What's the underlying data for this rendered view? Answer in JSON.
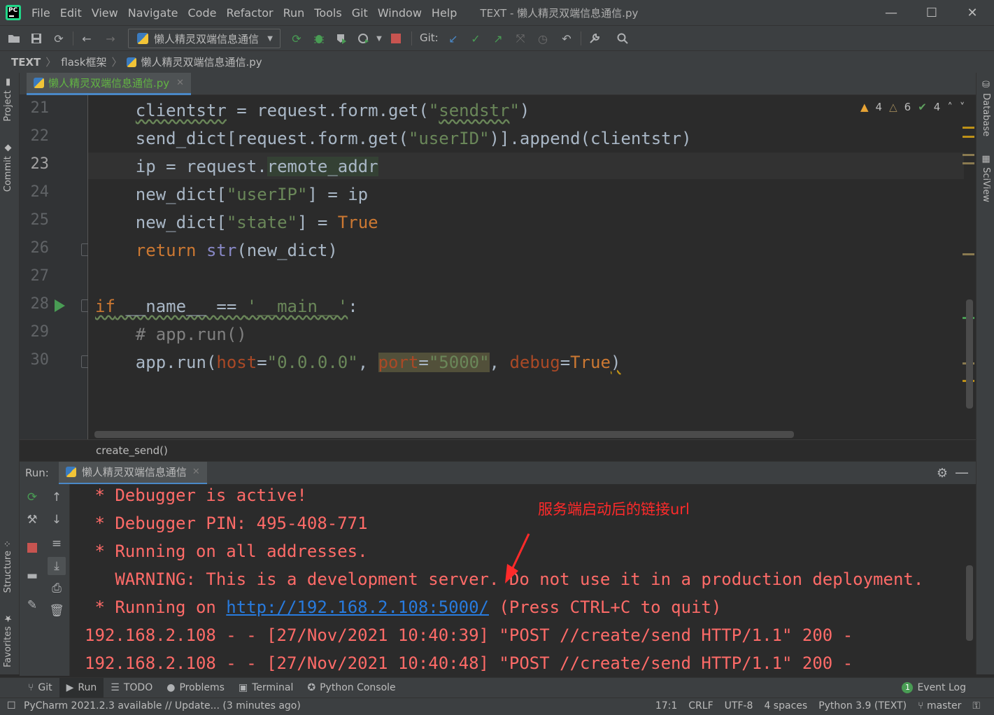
{
  "window": {
    "title": "TEXT - 懒人精灵双端信息通信.py",
    "minimize": "—",
    "maximize": "☐",
    "close": "✕"
  },
  "menu": [
    {
      "mn": "F",
      "rest": "ile"
    },
    {
      "mn": "E",
      "rest": "dit"
    },
    {
      "mn": "V",
      "rest": "iew",
      "pre": ""
    },
    {
      "mn": "N",
      "rest": "avigate"
    },
    {
      "mn": "C",
      "rest": "ode"
    },
    {
      "mn": "R",
      "rest": "efactor"
    },
    {
      "mn": "R",
      "rest": "un",
      "pre": ""
    },
    {
      "mn": "T",
      "rest": "ools"
    },
    {
      "mn": "G",
      "rest": "it"
    },
    {
      "mn": "W",
      "rest": "indow"
    },
    {
      "mn": "H",
      "rest": "elp"
    }
  ],
  "menu_labels": [
    "File",
    "Edit",
    "View",
    "Navigate",
    "Code",
    "Refactor",
    "Run",
    "Tools",
    "Git",
    "Window",
    "Help"
  ],
  "toolbar": {
    "run_config": "懒人精灵双端信息通信",
    "git_label": "Git:"
  },
  "breadcrumb": [
    "TEXT",
    "flask框架",
    "懒人精灵双端信息通信.py"
  ],
  "left_tabs": {
    "project": "Project",
    "commit": "Commit",
    "structure": "Structure",
    "favorites": "Favorites"
  },
  "right_tabs": {
    "database": "Database",
    "sciview": "SciView"
  },
  "editor": {
    "tab": "懒人精灵双端信息通信.py",
    "inspections": {
      "warnings": "4",
      "weak_warnings": "6",
      "ok": "4"
    },
    "line_numbers": [
      "21",
      "22",
      "23",
      "24",
      "25",
      "26",
      "27",
      "28",
      "29",
      "30"
    ],
    "current_function": "create_send()"
  },
  "run_panel": {
    "label": "Run:",
    "tab": "懒人精灵双端信息通信",
    "console": [
      " * Debugger is active!",
      " * Debugger PIN: 495-408-771",
      " * Running on all addresses.",
      "   WARNING: This is a development server. Do not use it in a production deployment."
    ],
    "running_prefix": " * Running on ",
    "url": "http://192.168.2.108:5000/",
    "running_suffix": " (Press CTRL+C to quit)",
    "log_lines": [
      "192.168.2.108 - - [27/Nov/2021 10:40:39] \"POST //create/send HTTP/1.1\" 200 -",
      "192.168.2.108 - - [27/Nov/2021 10:40:48] \"POST //create/send HTTP/1.1\" 200 -"
    ],
    "annotation": "服务端启动后的链接url"
  },
  "tool_windows": [
    "Git",
    "Run",
    "TODO",
    "Problems",
    "Terminal",
    "Python Console"
  ],
  "event_log": {
    "count": "1",
    "label": "Event Log"
  },
  "status": {
    "message": "PyCharm 2021.2.3 available // Update... (3 minutes ago)",
    "position": "17:1",
    "line_sep": "CRLF",
    "encoding": "UTF-8",
    "indent": "4 spaces",
    "interpreter": "Python 3.9 (TEXT)",
    "branch": "master"
  }
}
